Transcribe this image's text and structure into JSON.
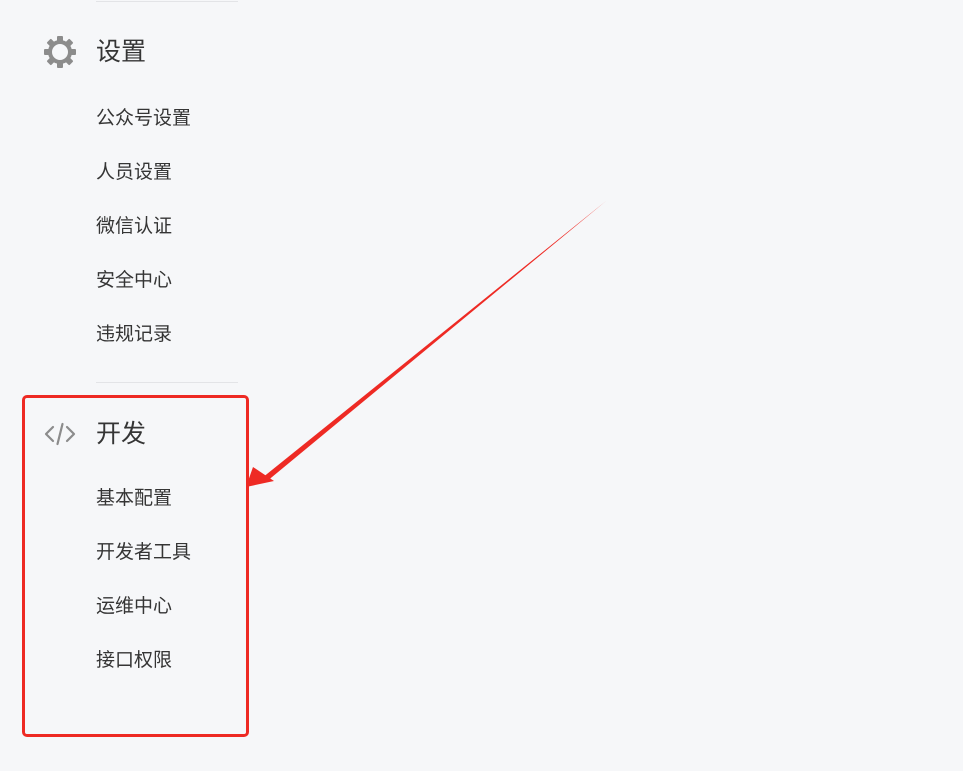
{
  "settings": {
    "icon": "gear-icon",
    "title": "设置",
    "items": [
      "公众号设置",
      "人员设置",
      "微信认证",
      "安全中心",
      "违规记录"
    ]
  },
  "development": {
    "icon": "code-icon",
    "title": "开发",
    "items": [
      "基本配置",
      "开发者工具",
      "运维中心",
      "接口权限"
    ]
  },
  "annotation": {
    "color": "#ee2a24",
    "shape": "arrow-and-box",
    "target": "development"
  }
}
